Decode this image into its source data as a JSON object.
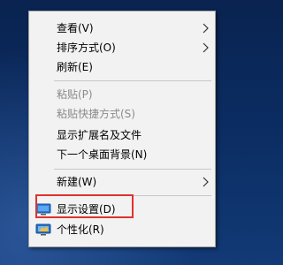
{
  "context_menu": {
    "items": [
      {
        "label": "查看(V)"
      },
      {
        "label": "排序方式(O)"
      },
      {
        "label": "刷新(E)"
      },
      {
        "label": "粘贴(P)"
      },
      {
        "label": "粘贴快捷方式(S)"
      },
      {
        "label": "显示扩展名及文件"
      },
      {
        "label": "下一个桌面背景(N)"
      },
      {
        "label": "新建(W)"
      },
      {
        "label": "显示设置(D)"
      },
      {
        "label": "个性化(R)"
      }
    ]
  },
  "icons": {
    "view_arrow": "chevron-right-icon",
    "sort_arrow": "chevron-right-icon",
    "new_arrow": "chevron-right-icon",
    "display_settings": "monitor-icon",
    "personalize": "personalize-monitor-icon"
  },
  "colors": {
    "desktop_background": "#0b2d63",
    "menu_background": "#f2f2f2",
    "disabled_text": "#8a8a8a",
    "highlight_border": "#e0322d"
  }
}
